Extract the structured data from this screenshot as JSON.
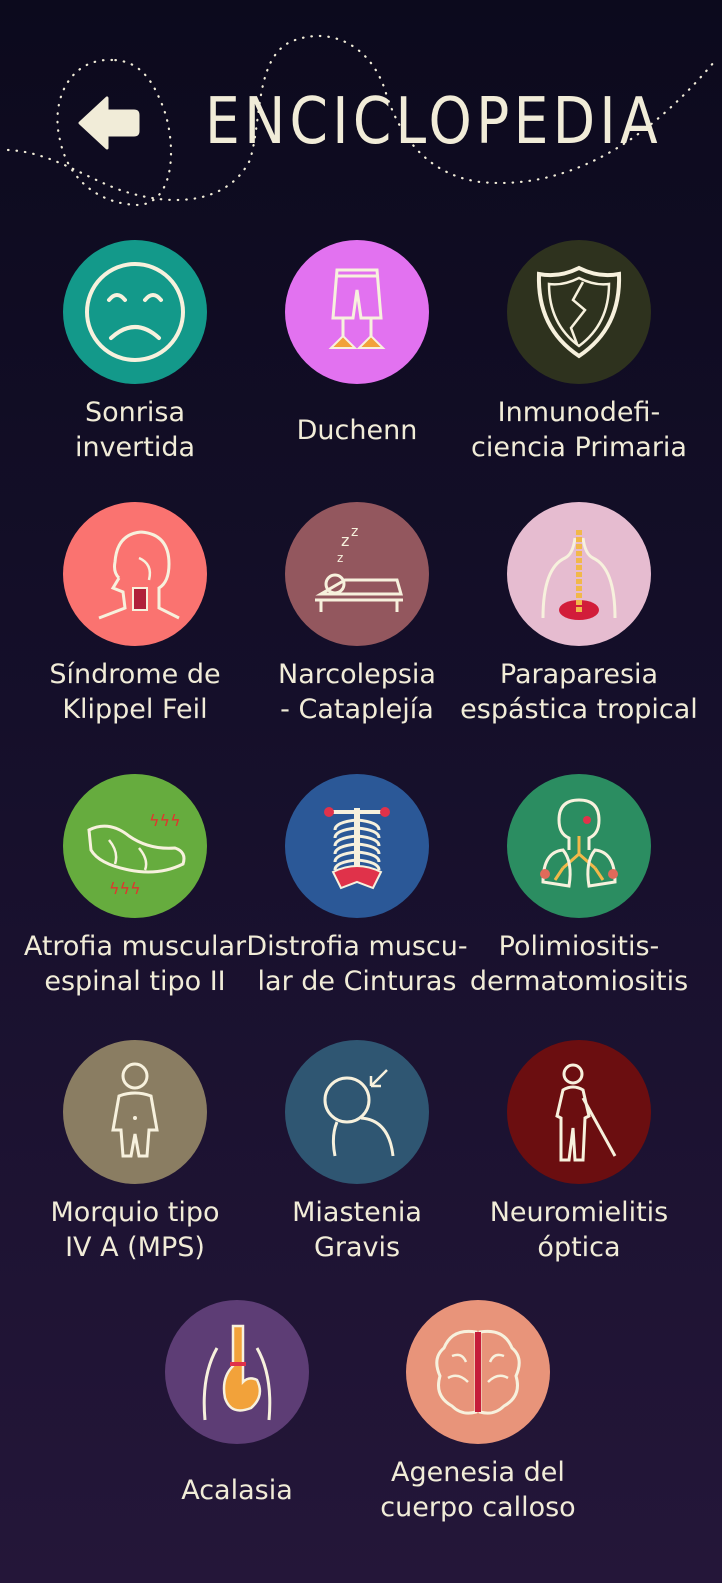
{
  "header": {
    "title": "ENCICLOPEDIA",
    "back_icon": "arrow-left-icon"
  },
  "colors": {
    "text": "#f1ecd8",
    "background_top": "#0c0a1d",
    "background_bottom": "#241639"
  },
  "items": [
    {
      "label": "Sonrisa\ninvertida",
      "color": "#13998a",
      "icon": "sad-face-icon"
    },
    {
      "label": "Duchenn",
      "color": "#e272f0",
      "icon": "shorts-duck-feet-icon"
    },
    {
      "label": "Inmunodefi-\nciencia Primaria",
      "color": "#2e321e",
      "icon": "broken-shield-icon"
    },
    {
      "label": "Síndrome de\nKlippel Feil",
      "color": "#fa7370",
      "icon": "head-neck-icon"
    },
    {
      "label": "Narcolepsia\n- Cataplejía",
      "color": "#93575e",
      "icon": "sleeping-person-icon"
    },
    {
      "label": "Paraparesia\nespástica tropical",
      "color": "#e6bcd0",
      "icon": "spine-back-icon"
    },
    {
      "label": "Atrofia muscular\nespinal tipo II",
      "color": "#66ac3e",
      "icon": "lying-body-icon"
    },
    {
      "label": "Distrofia muscu-\nlar de Cinturas",
      "color": "#2b5897",
      "icon": "skeleton-torso-icon"
    },
    {
      "label": "Polimiositis-\ndermatomiositis",
      "color": "#2b8d61",
      "icon": "lungs-icon"
    },
    {
      "label": "Morquio tipo\nIV A (MPS)",
      "color": "#8a7d62",
      "icon": "child-body-icon"
    },
    {
      "label": "Miastenia\nGravis",
      "color": "#2f5672",
      "icon": "drooping-head-icon"
    },
    {
      "label": "Neuromielitis\nóptica",
      "color": "#6b0e10",
      "icon": "person-with-cane-icon"
    },
    {
      "label": "Acalasia",
      "color": "#5d3d75",
      "icon": "stomach-icon"
    },
    {
      "label": "Agenesia del\ncuerpo calloso",
      "color": "#e8947a",
      "icon": "brain-icon"
    }
  ]
}
